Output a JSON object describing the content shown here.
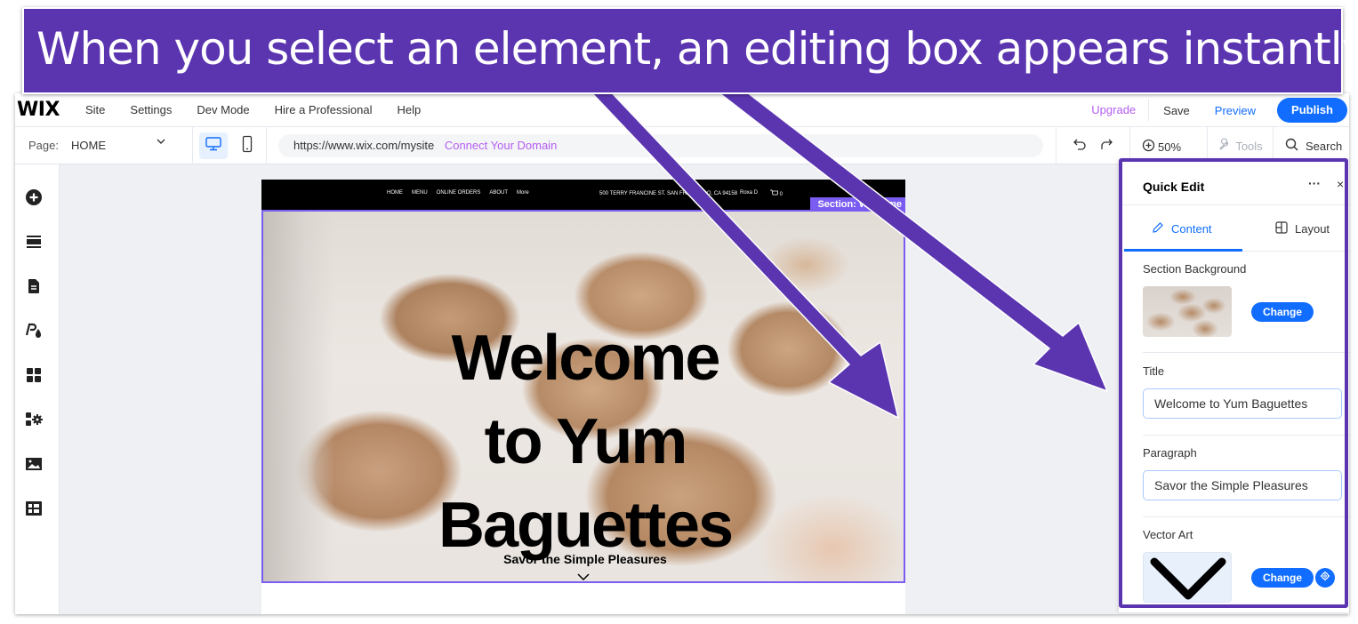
{
  "caption": {
    "text": "When you select an element, an editing box appears instantly",
    "background_color": "#5b35b0"
  },
  "topbar": {
    "logo": "WIX",
    "menu": [
      "Site",
      "Settings",
      "Dev Mode",
      "Hire a Professional",
      "Help"
    ],
    "upgrade": "Upgrade",
    "save": "Save",
    "preview": "Preview",
    "publish": "Publish"
  },
  "toolbar": {
    "page_label": "Page:",
    "page_value": "HOME",
    "url": "https://www.wix.com/mysite",
    "connect_domain": "Connect Your Domain",
    "zoom_level": "50%",
    "tools": "Tools",
    "search": "Search"
  },
  "rail": {
    "icons": [
      "add-icon",
      "sections-icon",
      "pages-icon",
      "theme-icon",
      "apps-icon",
      "business-apps-icon",
      "media-icon",
      "cms-table-icon"
    ]
  },
  "site": {
    "nav": [
      "HOME",
      "MENU",
      "ONLINE ORDERS",
      "ABOUT",
      "More"
    ],
    "address": "500 TERRY FRANCINE ST. SAN FRANCISCO, CA 94158",
    "user": "Roxa D",
    "cart_count": "0",
    "section_tag": "Section: Welcome",
    "hero_title_lines": [
      "Welcome",
      "to Yum",
      "Baguettes"
    ],
    "hero_subtitle": "Savor the Simple Pleasures"
  },
  "quick_edit": {
    "title": "Quick Edit",
    "more": "···",
    "close": "×",
    "tabs": [
      {
        "label": "Content",
        "active": true
      },
      {
        "label": "Layout",
        "active": false
      }
    ],
    "section_background_label": "Section Background",
    "change_label": "Change",
    "title_label": "Title",
    "title_value": "Welcome to Yum Baguettes",
    "paragraph_label": "Paragraph",
    "paragraph_value": "Savor the Simple Pleasures",
    "vector_art_label": "Vector Art",
    "accent_color": "#116dff"
  }
}
